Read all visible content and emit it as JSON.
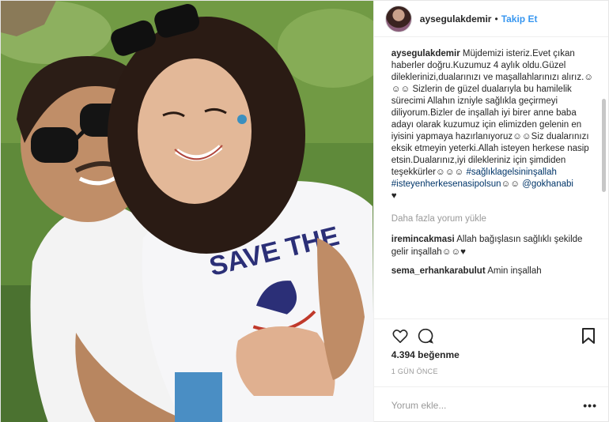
{
  "post": {
    "author": "aysegulakdemir",
    "follow_label": "Takip Et",
    "separator": "•",
    "photo_shirt_text": "SAVE THE"
  },
  "caption": {
    "user": "aysegulakdemir",
    "text": "Müjdemizi isteriz.Evet çıkan haberler doğru.Kuzumuz 4 aylık oldu.Güzel dileklerinizi,dualarınızı ve maşallahlarınızı alırız.☺☺☺ Sizlerin de güzel dualarıyla bu hamilelik sürecimi Allahın izniyle sağlıkla geçirmeyi diliyorum.Bizler de inşallah iyi birer anne baba adayı olarak kuzumuz için elimizden gelenin en iyisini yapmaya hazırlanıyoruz☺☺Siz dualarınızı eksik etmeyin yeterki.Allah isteyen herkese nasip etsin.Dualarınız,iyi dilekleriniz için şimdiden teşekkürler☺☺☺",
    "hashtag1": "#sağlıklagelsininşallah",
    "hashtag2": "#isteyenherkesenasipolsun",
    "hashtag2_suffix": "☺☺ ",
    "mention": "@gokhanabi",
    "heart": "♥"
  },
  "load_more": "Daha fazla yorum yükle",
  "comments": [
    {
      "user": "iremincakmasi",
      "text": "Allah bağışlasın sağlıklı şekilde gelir inşallah☺☺♥"
    },
    {
      "user": "sema_erhankarabulut",
      "text": "Amin inşallah"
    }
  ],
  "likes": "4.394 beğenme",
  "date": "1 GÜN ÖNCE",
  "add_comment_placeholder": "Yorum ekle...",
  "more_options": "•••",
  "icons": [
    "heart-icon",
    "comment-icon",
    "bookmark-icon"
  ],
  "colors": {
    "link": "#3897f0",
    "hashtag": "#003569",
    "muted": "#999999"
  }
}
